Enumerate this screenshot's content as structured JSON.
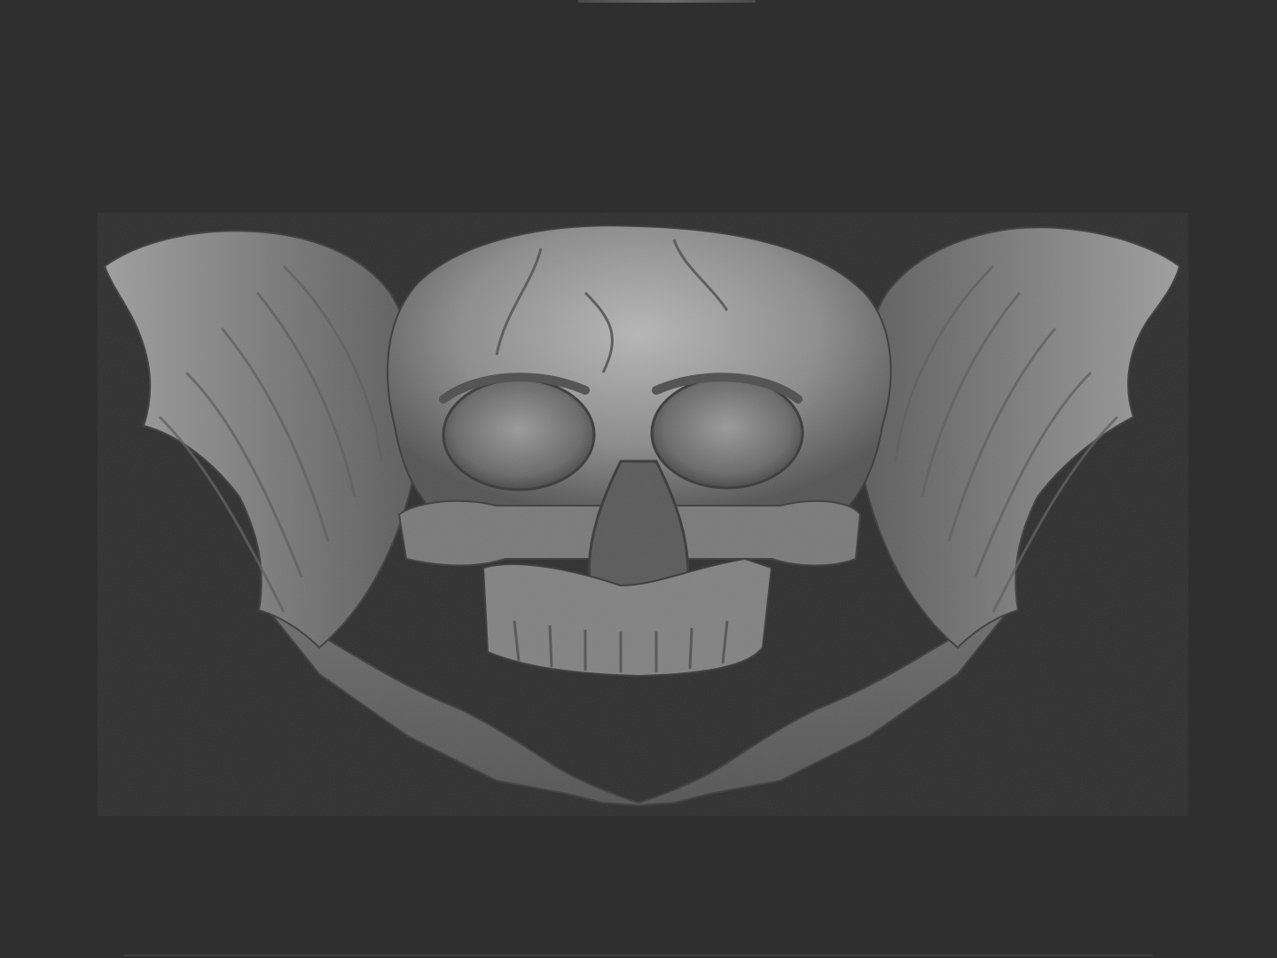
{
  "viewport": {
    "background": "#2f2f2f"
  },
  "model": {
    "subject": "skull-with-bat-wings",
    "material_color": "#8a8a8a",
    "shadow_color": "#3a3a3a",
    "highlight_color": "#c8c8c8"
  }
}
